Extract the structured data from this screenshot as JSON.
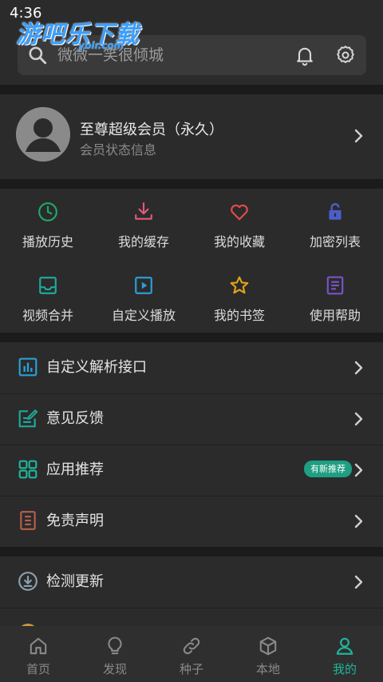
{
  "status_bar": {
    "time": "4:36"
  },
  "watermark": {
    "title": "游吧乐下载",
    "sub": "yblr.com"
  },
  "search": {
    "placeholder": "微微一笑很倾城"
  },
  "vip": {
    "title": "至尊超级会员（永久）",
    "subtitle": "会员状态信息"
  },
  "grid": [
    {
      "label": "播放历史",
      "icon": "clock-icon",
      "color": "#1fa86a"
    },
    {
      "label": "我的缓存",
      "icon": "download-icon",
      "color": "#e25a7a"
    },
    {
      "label": "我的收藏",
      "icon": "heart-icon",
      "color": "#e24b4b"
    },
    {
      "label": "加密列表",
      "icon": "lock-icon",
      "color": "#4b5ec9"
    },
    {
      "label": "视频合并",
      "icon": "tray-icon",
      "color": "#1fa89a"
    },
    {
      "label": "自定义播放",
      "icon": "play-square-icon",
      "color": "#2a9fd6"
    },
    {
      "label": "我的书签",
      "icon": "star-icon",
      "color": "#e2a21a"
    },
    {
      "label": "使用帮助",
      "icon": "document-icon",
      "color": "#7b52c9"
    }
  ],
  "list": [
    {
      "label": "自定义解析接口",
      "icon": "chart-icon",
      "color": "#2a9fd6"
    },
    {
      "label": "意见反馈",
      "icon": "edit-icon",
      "color": "#1fa89a"
    },
    {
      "label": "应用推荐",
      "icon": "apps-grid-icon",
      "color": "#1fb59a",
      "badge": "有新推荐"
    },
    {
      "label": "免责声明",
      "icon": "notepad-icon",
      "color": "#b5604a"
    }
  ],
  "update": {
    "label": "检测更新",
    "icon": "download-circle-icon",
    "color": "#8aa0b0"
  },
  "tabs": [
    {
      "label": "首页",
      "icon": "home-icon",
      "active": false
    },
    {
      "label": "发现",
      "icon": "lightbulb-icon",
      "active": false
    },
    {
      "label": "种子",
      "icon": "link-icon",
      "active": false
    },
    {
      "label": "本地",
      "icon": "cube-icon",
      "active": false
    },
    {
      "label": "我的",
      "icon": "person-icon",
      "active": true
    }
  ],
  "colors": {
    "accent": "#1fb59a",
    "background": "#1b1b1b",
    "card": "#2b2b2b"
  }
}
